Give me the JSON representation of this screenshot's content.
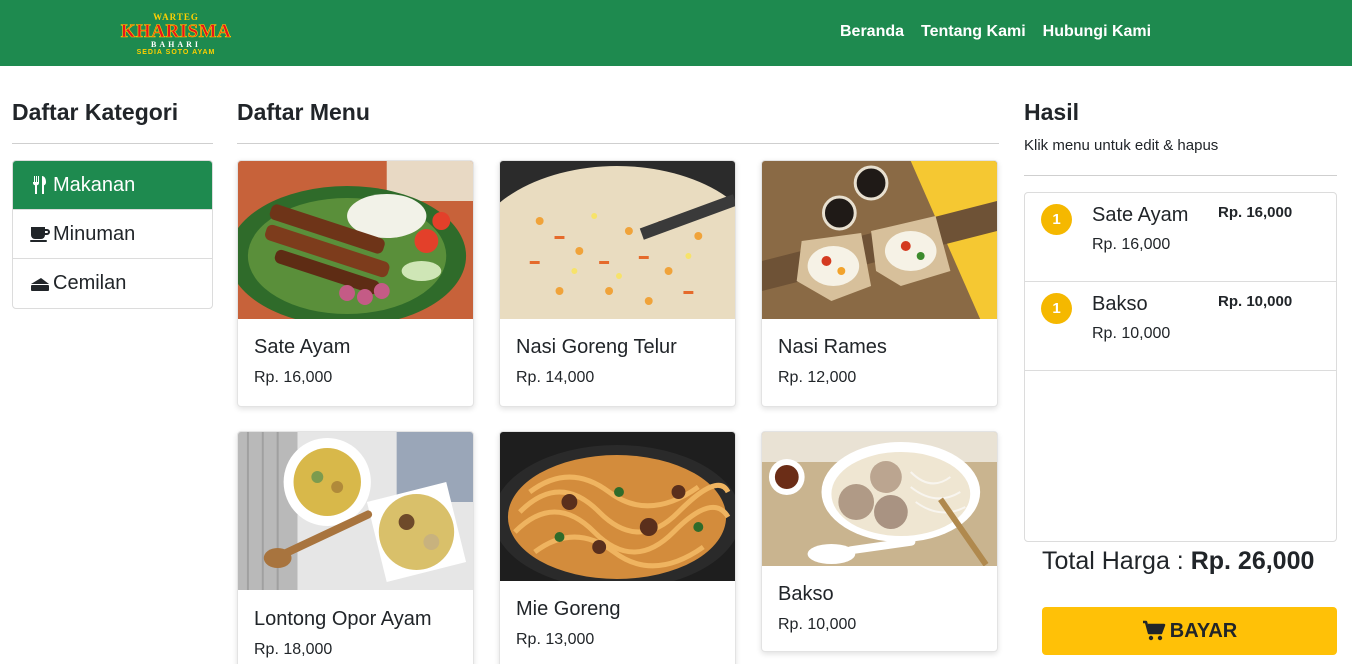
{
  "navbar": {
    "brand": {
      "line1": "WARTEG",
      "line2": "KHARISMA",
      "line3": "BAHARI",
      "line4": "SEDIA SOTO AYAM"
    },
    "links": [
      "Beranda",
      "Tentang Kami",
      "Hubungi Kami"
    ],
    "color": "#1e8a4f"
  },
  "kategori": {
    "title": "Daftar Kategori",
    "items": [
      {
        "label": "Makanan",
        "icon": "utensils-icon",
        "active": true
      },
      {
        "label": "Minuman",
        "icon": "coffee-icon",
        "active": false
      },
      {
        "label": "Cemilan",
        "icon": "cake-icon",
        "active": false
      }
    ]
  },
  "menu": {
    "title": "Daftar Menu",
    "items": [
      {
        "name": "Sate Ayam",
        "price": "Rp. 16,000",
        "image": "sate-ayam-image"
      },
      {
        "name": "Nasi Goreng Telur",
        "price": "Rp. 14,000",
        "image": "nasi-goreng-image"
      },
      {
        "name": "Nasi Rames",
        "price": "Rp. 12,000",
        "image": "nasi-rames-image"
      },
      {
        "name": "Lontong Opor Ayam",
        "price": "Rp. 18,000",
        "image": "lontong-opor-image"
      },
      {
        "name": "Mie Goreng",
        "price": "Rp. 13,000",
        "image": "mie-goreng-image"
      },
      {
        "name": "Bakso",
        "price": "Rp. 10,000",
        "image": "bakso-image"
      }
    ]
  },
  "hasil": {
    "title": "Hasil",
    "subtitle": "Klik menu untuk edit & hapus",
    "orders": [
      {
        "qty": "1",
        "name": "Sate Ayam",
        "price": "Rp. 16,000",
        "total": "Rp. 16,000"
      },
      {
        "qty": "1",
        "name": "Bakso",
        "price": "Rp. 10,000",
        "total": "Rp. 10,000"
      }
    ],
    "total_label": "Total Harga :",
    "total_value": "Rp. 26,000",
    "pay_label": "BAYAR",
    "accent": "#ffc107"
  }
}
